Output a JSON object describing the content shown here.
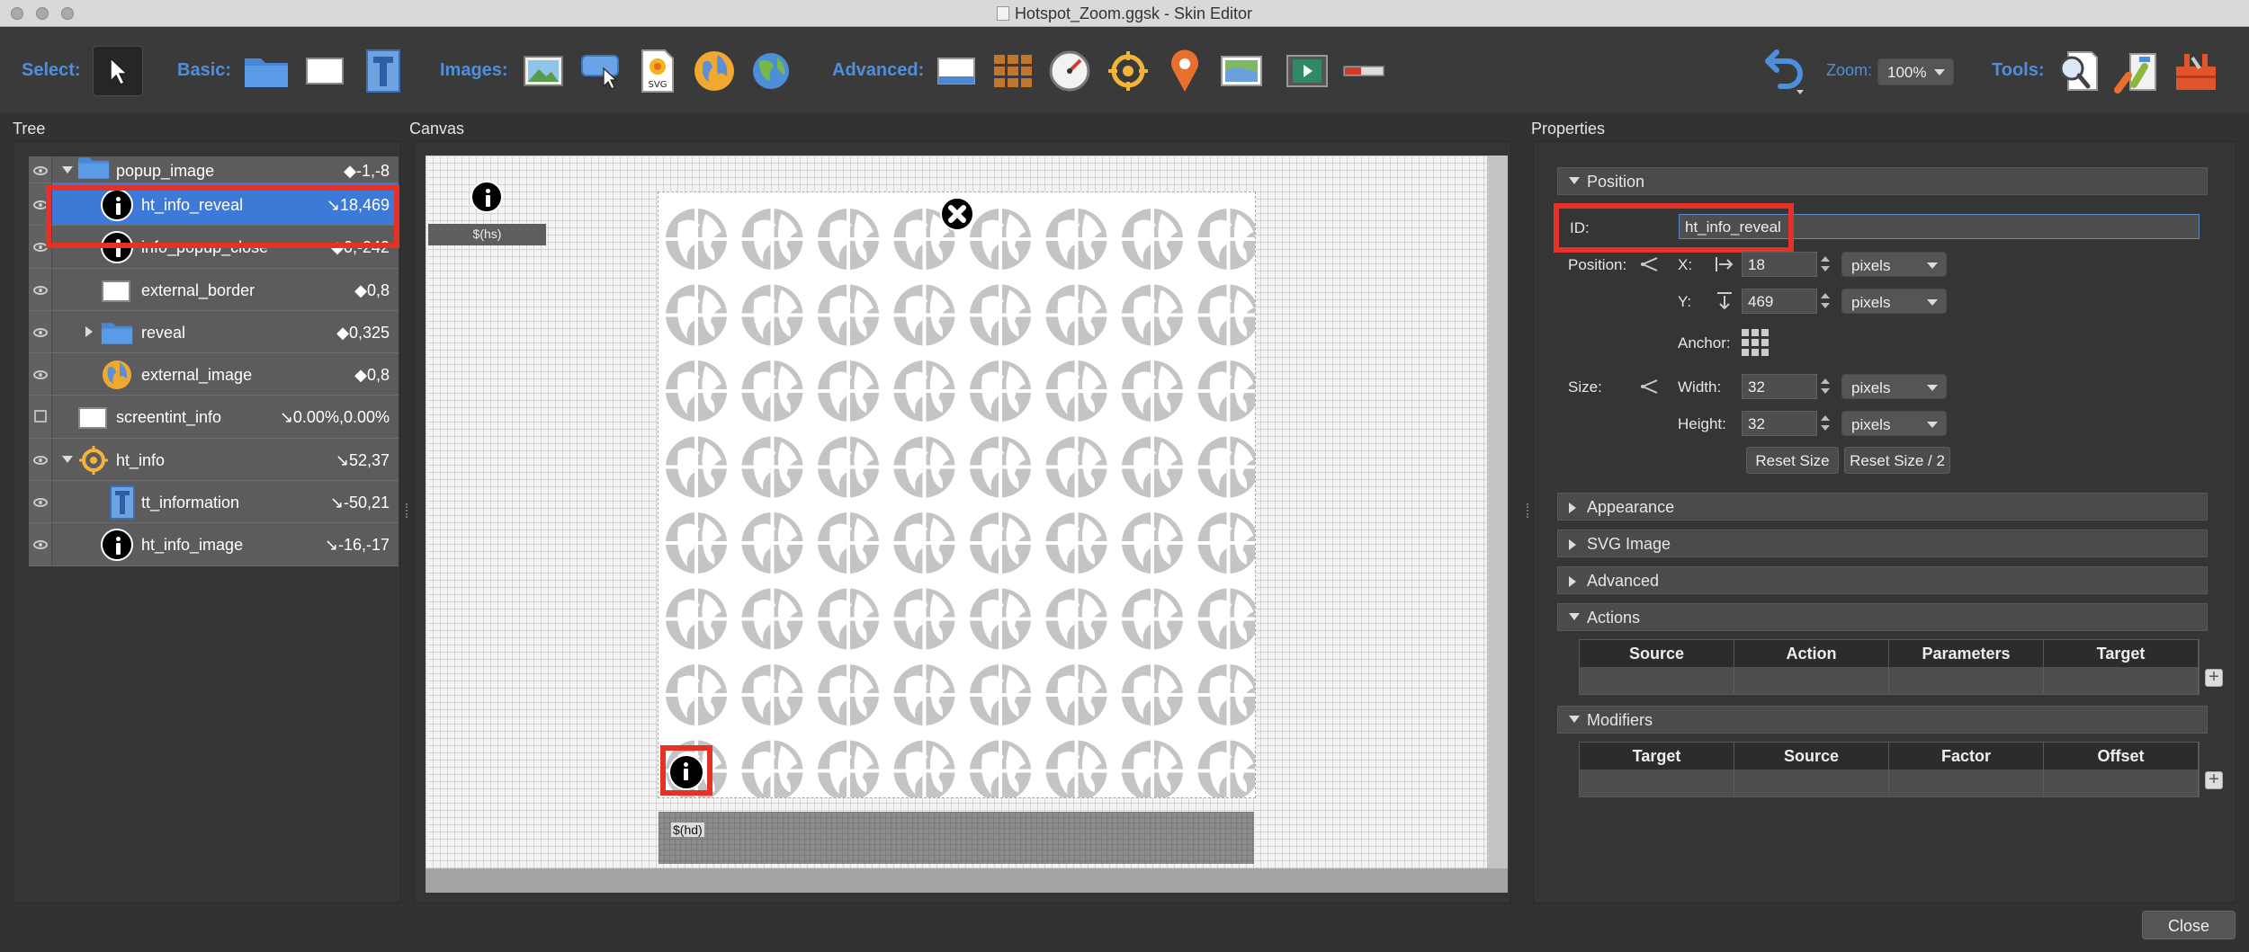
{
  "window": {
    "title": "Hotspot_Zoom.ggsk - Skin Editor"
  },
  "toolbar": {
    "select_label": "Select:",
    "basic_label": "Basic:",
    "images_label": "Images:",
    "advanced_label": "Advanced:",
    "zoom_label": "Zoom:",
    "zoom_value": "100%",
    "tools_label": "Tools:",
    "svg_text": "SVG"
  },
  "tree": {
    "title": "Tree",
    "rows": [
      {
        "name": "popup_image",
        "value": "◆-1,-8"
      },
      {
        "name": "ht_info_reveal",
        "value": "↘18,469"
      },
      {
        "name": "info_popup_close",
        "value": "◆0,-242"
      },
      {
        "name": "external_border",
        "value": "◆0,8"
      },
      {
        "name": "reveal",
        "value": "◆0,325"
      },
      {
        "name": "external_image",
        "value": "◆0,8"
      },
      {
        "name": "screentint_info",
        "value": "↘0.00%,0.00%"
      },
      {
        "name": "ht_info",
        "value": "↘52,37"
      },
      {
        "name": "tt_information",
        "value": "↘-50,21"
      },
      {
        "name": "ht_info_image",
        "value": "↘-16,-17"
      }
    ]
  },
  "canvas": {
    "title": "Canvas",
    "hs_label": "$(hs)",
    "hd_label": "$(hd)"
  },
  "properties": {
    "title": "Properties",
    "position_section": "Position",
    "id_label": "ID:",
    "id_value": "ht_info_reveal",
    "position_label": "Position:",
    "x_label": "X:",
    "x_value": "18",
    "y_label": "Y:",
    "y_value": "469",
    "unit": "pixels",
    "anchor_label": "Anchor:",
    "size_label": "Size:",
    "width_label": "Width:",
    "width_value": "32",
    "height_label": "Height:",
    "height_value": "32",
    "reset_size": "Reset Size",
    "reset_size_half": "Reset Size / 2",
    "appearance_section": "Appearance",
    "svg_section": "SVG Image",
    "advanced_section": "Advanced",
    "actions_section": "Actions",
    "actions_columns": [
      "Source",
      "Action",
      "Parameters",
      "Target"
    ],
    "modifiers_section": "Modifiers",
    "modifiers_columns": [
      "Target",
      "Source",
      "Factor",
      "Offset"
    ]
  },
  "footer": {
    "close": "Close"
  },
  "colors": {
    "accent": "#4e8fdc",
    "selection": "#3d7ad7",
    "highlight": "#e53128"
  }
}
